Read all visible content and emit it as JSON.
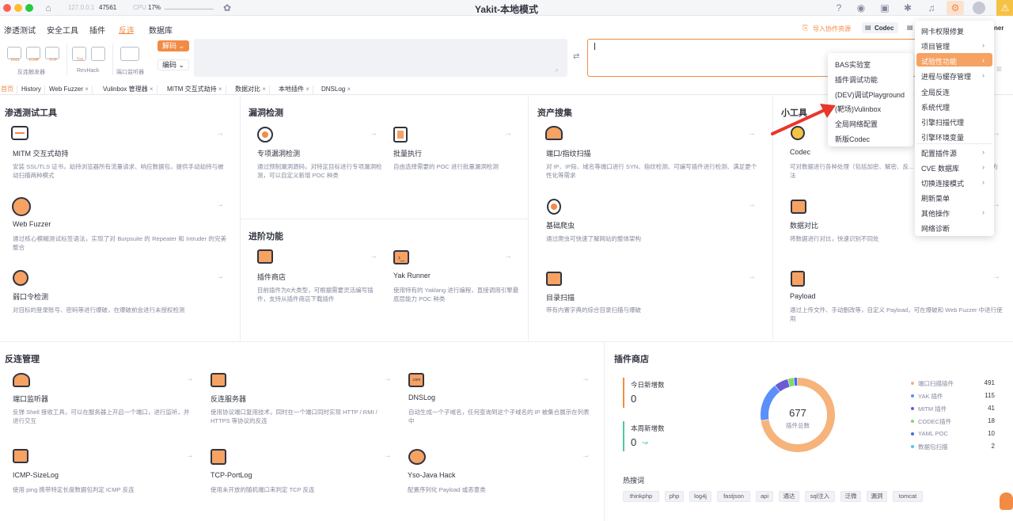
{
  "titlebar": {
    "address": "127.0.0.1",
    "port": "47561",
    "cpu_label": "CPU",
    "cpu_value": "17%",
    "title": "Yakit-本地模式"
  },
  "colors": {
    "accent": "#f28b44",
    "highlight": "#f6a263",
    "tl_red": "#fe5f57",
    "tl_yellow": "#febc2e",
    "tl_green": "#28c840"
  },
  "menu": {
    "items": [
      "渗透测试",
      "安全工具",
      "插件",
      "反连",
      "数据库"
    ],
    "active": "反连",
    "groups": {
      "reverse_trigger": {
        "icons": [
          "DNS",
          "ICMP",
          "TCP"
        ],
        "label": "反连触发器"
      },
      "revhack": {
        "label": "RevHack",
        "icon": "Yso"
      },
      "port_monitor": {
        "label": "端口监听器"
      }
    },
    "import_resources": "导入协作资源",
    "codec_btn": "Codec",
    "right_cut": "ner"
  },
  "codec": {
    "decode_btn": "解码",
    "encode_btn": "编码",
    "swap_icon": "swap-arrows-icon"
  },
  "tabs": [
    "首页",
    "History",
    "Web Fuzzer",
    "Vulinbox 管理器",
    "MITM 交互式劫持",
    "数据对比",
    "本地插件",
    "DNSLog"
  ],
  "sections": {
    "pentest": {
      "title": "渗透测试工具",
      "cards": [
        {
          "title": "MITM 交互式劫持",
          "desc": "安装 SSL/TLS 证书，劫持浏览器所有流量请求、响应数据包，提供手动劫持与被动扫描两种模式"
        },
        {
          "title": "Web Fuzzer",
          "desc": "通过核心模糊测试标签语法，实现了对 Burpsuite 的 Repeater 和 Intruder 的完美整合"
        },
        {
          "title": "弱口令检测",
          "desc": "对目标的登录账号、密码等进行爆破，在爆破前会进行未授权检测"
        }
      ]
    },
    "vuln": {
      "title": "漏洞检测",
      "cards": [
        {
          "title": "专项漏洞检测",
          "desc": "通过预制漏洞源码，对特定目标进行专项漏洞检测，可以自定义新增 POC 种类"
        },
        {
          "title": "批量执行",
          "desc": "自由选择需要的 POC 进行批量漏洞检测"
        }
      ]
    },
    "advanced": {
      "title": "进阶功能",
      "cards": [
        {
          "title": "插件商店",
          "desc": "目前插件为6大类型，可根据需要灵活编写插件，支持从插件商店下载插件"
        },
        {
          "title": "Yak Runner",
          "desc": "使用特有的 Yaklang 进行编程，直接调用引擎最底层能力 POC 种类"
        }
      ]
    },
    "asset": {
      "title": "资产搜集",
      "cards": [
        {
          "title": "端口/指纹扫描",
          "desc": "对 IP、IP段、域名等端口进行 SYN、指纹检测、可编写插件进行检测、满足更个性化等需求"
        },
        {
          "title": "基础爬虫",
          "desc": "通过爬虫可快速了解网站的整体架构"
        },
        {
          "title": "目录扫描",
          "desc": "带有内置字典的综合目录扫描与爆破"
        }
      ]
    },
    "tools": {
      "title": "小工具",
      "cards": [
        {
          "title": "Codec",
          "desc": "可对数据进行各种处理（包括加密、解密、反... 还可通过插件自定义数据处理方法"
        },
        {
          "title": "数据对比",
          "desc": "将数据进行对比，快速识别不同处"
        },
        {
          "title": "Payload",
          "desc": "通过上传文件、手动删改等，自定义 Payload，可在爆破和 Web Fuzzer 中进行使用"
        }
      ]
    },
    "reverse": {
      "title": "反连管理",
      "cards": [
        {
          "title": "端口监听器",
          "desc": "反弹 Shell 接收工具，可以在服务器上开启一个端口，进行监听，并进行交互"
        },
        {
          "title": "反连服务器",
          "desc": "使用协议端口复用技术，同时在一个端口同时实现 HTTP / RMI / HTTPS 等协议的反连"
        },
        {
          "title": "DNSLog",
          "desc": "自动生成一个子域名，任何查询到这个子域名的 IP 被集合展示在列表中"
        },
        {
          "title": "ICMP-SizeLog",
          "desc": "使用 ping 携带特定长度数据包判定 ICMP 反连"
        },
        {
          "title": "TCP-PortLog",
          "desc": "使用未开放的随机端口来判定 TCP 反连"
        },
        {
          "title": "Yso-Java Hack",
          "desc": "配置序列化 Payload 或恶意类"
        }
      ]
    },
    "store": {
      "title": "插件商店",
      "today_label": "今日新增数",
      "today_value": "0",
      "week_label": "本周新增数",
      "week_value": "0",
      "total_value": "677",
      "total_label": "插件总数",
      "legend": [
        {
          "label": "端口扫描插件",
          "value": 491,
          "color": "#f6b37a"
        },
        {
          "label": "YAK 插件",
          "value": 115,
          "color": "#5b8ff9"
        },
        {
          "label": "MITM 插件",
          "value": 41,
          "color": "#6b5bd6"
        },
        {
          "label": "CODEC插件",
          "value": 18,
          "color": "#7fd96b"
        },
        {
          "label": "YAML POC",
          "value": 10,
          "color": "#4a67e8"
        },
        {
          "label": "数据包扫描",
          "value": 2,
          "color": "#4ec9e3"
        }
      ],
      "hot_title": "热搜词",
      "hot_words": [
        "thinkphp",
        "php",
        "log4j",
        "fastjson",
        "api",
        "通达",
        "sql注入",
        "泛微",
        "漏洞",
        "tomcat"
      ]
    }
  },
  "settings_menu": {
    "items": [
      "网卡权限修复",
      "项目管理",
      "试验性功能",
      "进程与缓存管理",
      "全局反连",
      "系统代理",
      "引擎扫描代理",
      "引擎环境变量",
      "配置插件源",
      "CVE 数据库",
      "切换连接模式",
      "刷新菜单",
      "其他操作",
      "网络诊断"
    ],
    "highlighted": "试验性功能"
  },
  "experimental_menu": {
    "items": [
      "BAS实验室",
      "插件调试功能",
      "(DEV)调试Playground",
      "(靶场)Vulinbox",
      "全局网络配置",
      "新版Codec"
    ]
  }
}
